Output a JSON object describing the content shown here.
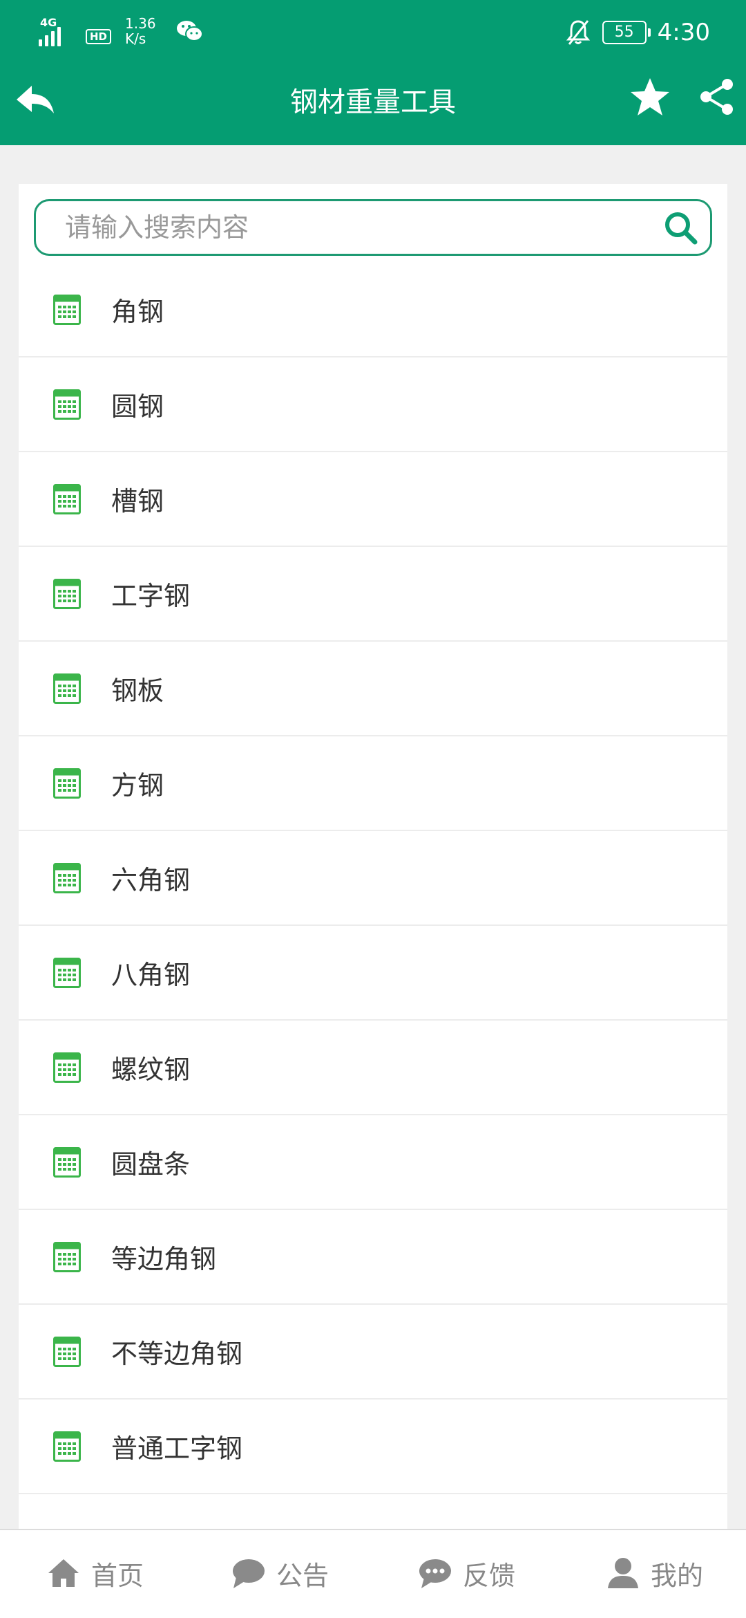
{
  "status_bar": {
    "network": "4G",
    "hd": "HD",
    "speed_value": "1.36",
    "speed_unit": "K/s",
    "battery": "55",
    "time": "4:30"
  },
  "app_bar": {
    "title": "钢材重量工具"
  },
  "search": {
    "placeholder": "请输入搜索内容",
    "value": ""
  },
  "items": [
    {
      "label": "角钢"
    },
    {
      "label": "圆钢"
    },
    {
      "label": "槽钢"
    },
    {
      "label": "工字钢"
    },
    {
      "label": "钢板"
    },
    {
      "label": "方钢"
    },
    {
      "label": "六角钢"
    },
    {
      "label": "八角钢"
    },
    {
      "label": "螺纹钢"
    },
    {
      "label": "圆盘条"
    },
    {
      "label": "等边角钢"
    },
    {
      "label": "不等边角钢"
    },
    {
      "label": "普通工字钢"
    }
  ],
  "tabs": [
    {
      "label": "首页",
      "icon": "home-icon"
    },
    {
      "label": "公告",
      "icon": "chat-bubble-icon"
    },
    {
      "label": "反馈",
      "icon": "message-dots-icon"
    },
    {
      "label": "我的",
      "icon": "user-icon"
    }
  ],
  "colors": {
    "primary": "#059d72",
    "icon_green": "#3bb54a",
    "text": "#333333",
    "tab_text": "#888888"
  }
}
